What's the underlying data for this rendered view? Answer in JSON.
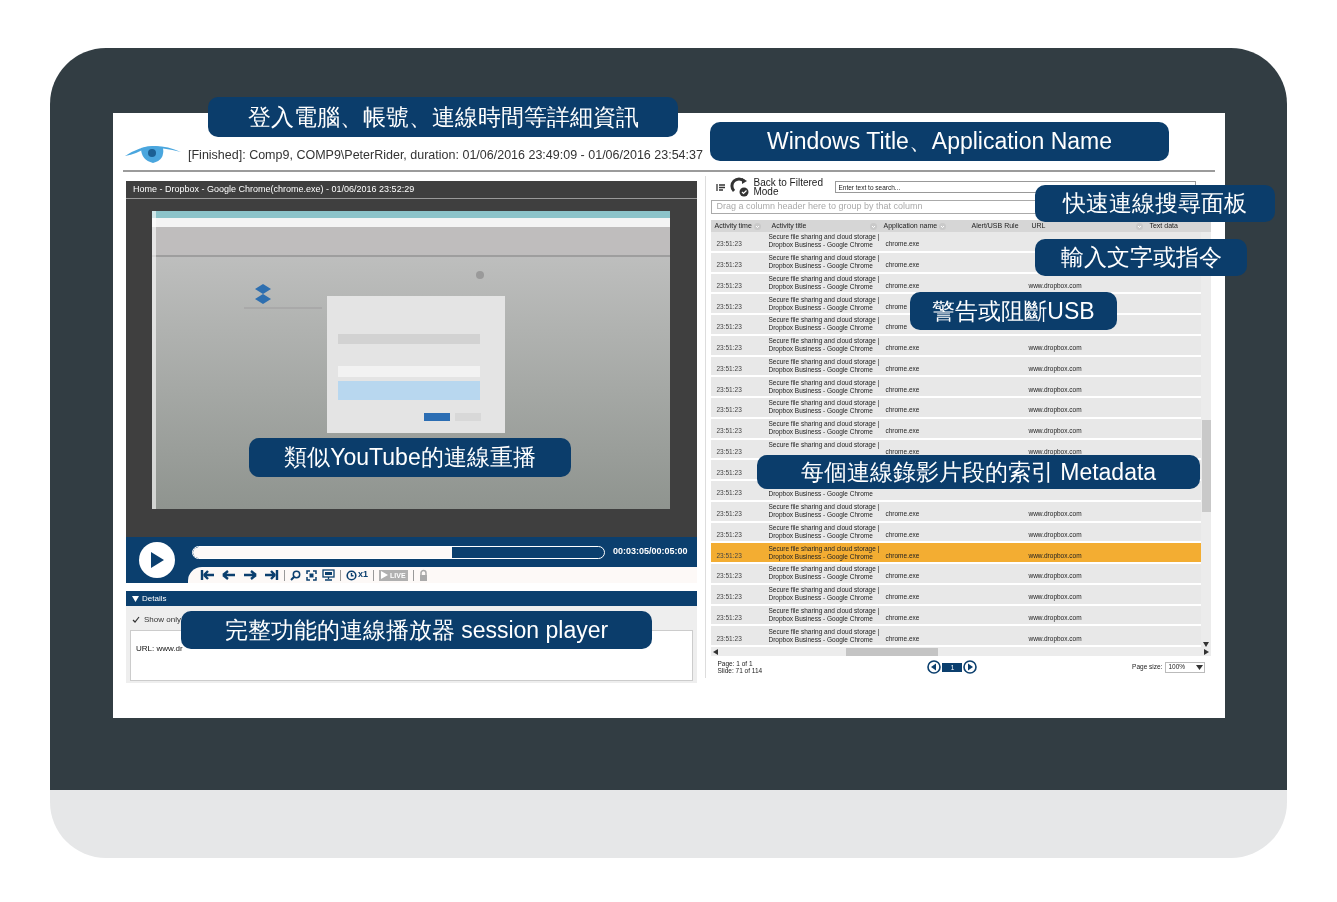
{
  "header": {
    "session": "[Finished]: Comp9, COMP9\\PeterRider, duration: 01/06/2016 23:49:09 - 01/06/2016 23:54:37"
  },
  "player": {
    "title": "Home - Dropbox - Google Chrome(chrome.exe) - 01/06/2016 23:52:29",
    "level": 0.63,
    "time": "00:03:05/00:05:00",
    "speed": "x1",
    "live": "LIVE"
  },
  "details": {
    "label": "Details",
    "expanded": true,
    "show_only": {
      "label": "Show only",
      "checked": true
    },
    "text": "URL: www.dr"
  },
  "activity": {
    "back_button": "Back to Filtered Mode",
    "search": {
      "placeholder": "Enter text to search..."
    },
    "group_hint": "Drag a column header here to group by that column",
    "columns": [
      "Activity time",
      "Activity title",
      "Application name",
      "Alert/USB Rule",
      "URL",
      "Text data"
    ],
    "rows": [
      {
        "time": "23:51:23",
        "title_line_1": "Secure file sharing and cloud storage |",
        "title_line_2": "Dropbox Business - Google Chrome",
        "app": "chrome.exe",
        "selected": false
      },
      {
        "time": "23:51:23",
        "title_line_1": "Secure file sharing and cloud storage |",
        "title_line_2": "Dropbox Business - Google Chrome",
        "app": "chrome.exe",
        "selected": false
      },
      {
        "time": "23:51:23",
        "title_line_1": "Secure file sharing and cloud storage |",
        "title_line_2": "Dropbox Business - Google Chrome",
        "app": "chrome.exe",
        "url": "www.dropbox.com",
        "selected": false
      },
      {
        "time": "23:51:23",
        "title_line_1": "Secure file sharing and cloud storage |",
        "title_line_2": "Dropbox Business - Google Chrome",
        "app": "chrome",
        "selected": false
      },
      {
        "time": "23:51:23",
        "title_line_1": "Secure file sharing and cloud storage |",
        "title_line_2": "Dropbox Business - Google Chrome",
        "app": "chrome",
        "selected": false
      },
      {
        "time": "23:51:23",
        "title_line_1": "Secure file sharing and cloud storage |",
        "title_line_2": "Dropbox Business - Google Chrome",
        "app": "chrome.exe",
        "url": "www.dropbox.com",
        "selected": false
      },
      {
        "time": "23:51:23",
        "title_line_1": "Secure file sharing and cloud storage |",
        "title_line_2": "Dropbox Business - Google Chrome",
        "app": "chrome.exe",
        "url": "www.dropbox.com",
        "selected": false
      },
      {
        "time": "23:51:23",
        "title_line_1": "Secure file sharing and cloud storage |",
        "title_line_2": "Dropbox Business - Google Chrome",
        "app": "chrome.exe",
        "url": "www.dropbox.com",
        "selected": false
      },
      {
        "time": "23:51:23",
        "title_line_1": "Secure file sharing and cloud storage |",
        "title_line_2": "Dropbox Business - Google Chrome",
        "app": "chrome.exe",
        "url": "www.dropbox.com",
        "selected": false
      },
      {
        "time": "23:51:23",
        "title_line_1": "Secure file sharing and cloud storage |",
        "title_line_2": "Dropbox Business - Google Chrome",
        "app": "chrome.exe",
        "url": "www.dropbox.com",
        "selected": false
      },
      {
        "time": "23:51:23",
        "title_line_1": "Secure file sharing and cloud storage |",
        "app": "chrome.exe",
        "url": "www.dropbox.com",
        "selected": false
      },
      {
        "time": "23:51:23",
        "selected": false
      },
      {
        "time": "23:51:23",
        "title_line_2": "Dropbox Business - Google Chrome",
        "selected": false
      },
      {
        "time": "23:51:23",
        "title_line_1": "Secure file sharing and cloud storage |",
        "title_line_2": "Dropbox Business - Google Chrome",
        "app": "chrome.exe",
        "url": "www.dropbox.com",
        "selected": false
      },
      {
        "time": "23:51:23",
        "title_line_1": "Secure file sharing and cloud storage |",
        "title_line_2": "Dropbox Business - Google Chrome",
        "app": "chrome.exe",
        "url": "www.dropbox.com",
        "selected": false
      },
      {
        "time": "23:51:23",
        "title_line_1": "Secure file sharing and cloud storage |",
        "title_line_2": "Dropbox Business - Google Chrome",
        "app": "chrome.exe",
        "url": "www.dropbox.com",
        "selected": true
      },
      {
        "time": "23:51:23",
        "title_line_1": "Secure file sharing and cloud storage |",
        "title_line_2": "Dropbox Business - Google Chrome",
        "app": "chrome.exe",
        "url": "www.dropbox.com",
        "selected": false
      },
      {
        "time": "23:51:23",
        "title_line_1": "Secure file sharing and cloud storage |",
        "title_line_2": "Dropbox Business - Google Chrome",
        "app": "chrome.exe",
        "url": "www.dropbox.com",
        "selected": false
      },
      {
        "time": "23:51:23",
        "title_line_1": "Secure file sharing and cloud storage |",
        "title_line_2": "Dropbox Business - Google Chrome",
        "app": "chrome.exe",
        "url": "www.dropbox.com",
        "selected": false
      },
      {
        "time": "23:51:23",
        "title_line_1": "Secure file sharing and cloud storage |",
        "title_line_2": "Dropbox Business - Google Chrome",
        "app": "chrome.exe",
        "url": "www.dropbox.com",
        "selected": false
      }
    ],
    "page": "Page: 1 of 1",
    "slide": "Slide: 71 of 114",
    "current_page": "1",
    "page_size_label": "Page size:",
    "page_size": "100%"
  },
  "callouts": [
    {
      "text": "登入電腦、帳號、連線時間等詳細資訊"
    },
    {
      "text": "Windows Title、Application Name"
    },
    {
      "text": "快速連線搜尋面板"
    },
    {
      "text": "輸入文字或指令"
    },
    {
      "text": "警告或阻斷USB"
    },
    {
      "text": "類似YouTube的連線重播"
    },
    {
      "text": "每個連線錄影片段的索引 Metadata"
    },
    {
      "text": "完整功能的連線播放器 session player"
    }
  ]
}
